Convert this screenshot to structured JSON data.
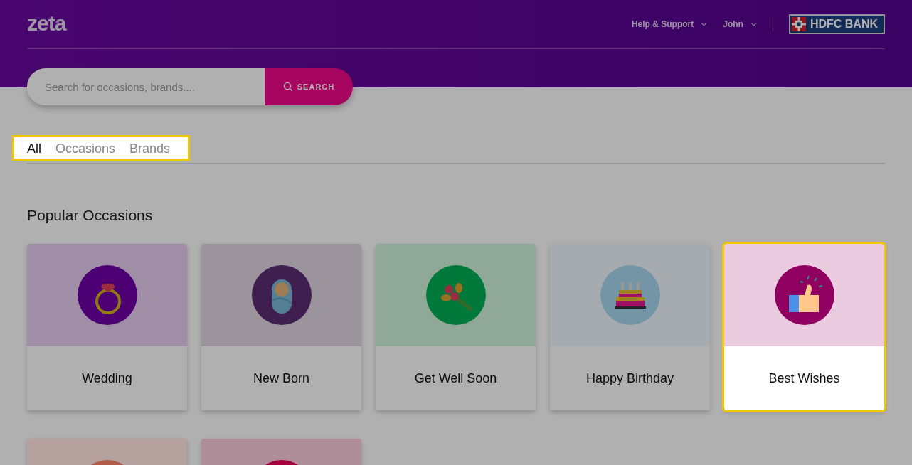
{
  "header": {
    "logo": "zeta",
    "nav": [
      {
        "label": "Help & Support"
      },
      {
        "label": "John"
      }
    ],
    "bank": "HDFC BANK"
  },
  "search": {
    "placeholder": "Search for occasions, brands....",
    "button": "SEARCH"
  },
  "tabs": {
    "highlighted": true,
    "items": [
      {
        "label": "All",
        "selected": true
      },
      {
        "label": "Occasions",
        "selected": false
      },
      {
        "label": "Brands",
        "selected": false
      }
    ]
  },
  "section": {
    "title": "Popular Occasions"
  },
  "cards": [
    {
      "label": "Wedding",
      "color": "#a08ea6",
      "highlighted": false
    },
    {
      "label": "New Born",
      "color": "#9c949c",
      "highlighted": false
    },
    {
      "label": "Get Well Soon",
      "color": "#8fa898",
      "highlighted": false
    },
    {
      "label": "Happy Birthday",
      "color": "#a6abaf",
      "highlighted": false
    },
    {
      "label": "Best Wishes",
      "color": "#ebcbe0",
      "highlighted": true
    },
    {
      "color": "#b5a29e",
      "highlighted": false
    },
    {
      "color": "#af8e9a",
      "highlighted": false
    }
  ]
}
